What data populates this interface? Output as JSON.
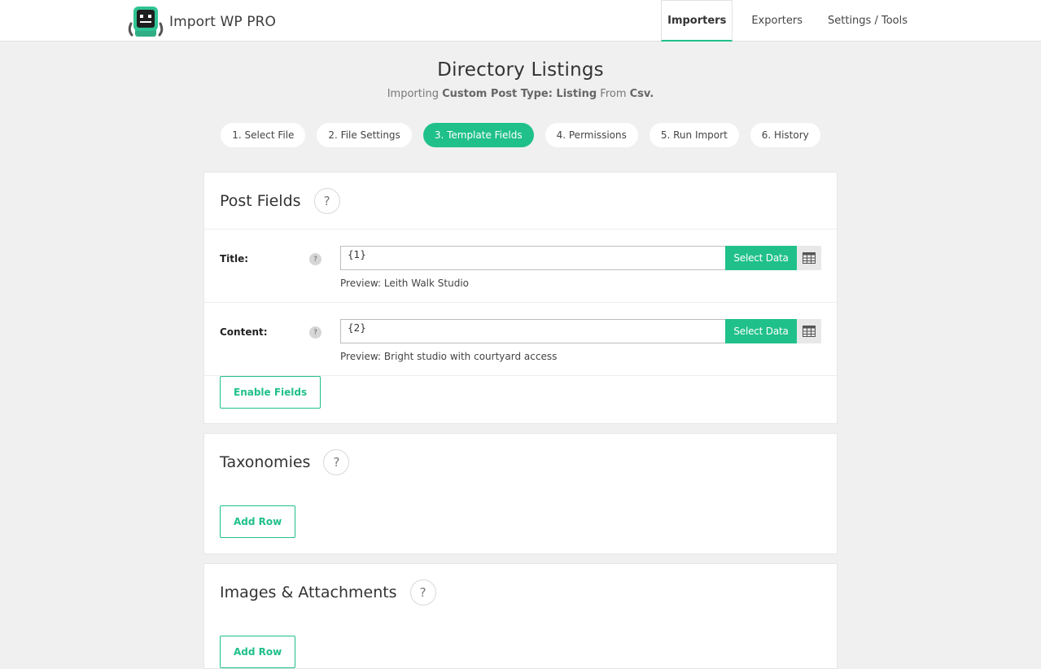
{
  "app": {
    "name": "Import WP PRO"
  },
  "nav": {
    "items": [
      {
        "label": "Importers",
        "active": true
      },
      {
        "label": "Exporters",
        "active": false
      },
      {
        "label": "Settings / Tools",
        "active": false
      }
    ]
  },
  "page": {
    "title": "Directory Listings",
    "sub_prefix": "Importing",
    "sub_type": "Custom Post Type: Listing",
    "sub_from": "From",
    "sub_source": "Csv."
  },
  "steps": [
    {
      "label": "1. Select File",
      "active": false
    },
    {
      "label": "2. File Settings",
      "active": false
    },
    {
      "label": "3. Template Fields",
      "active": true
    },
    {
      "label": "4. Permissions",
      "active": false
    },
    {
      "label": "5. Run Import",
      "active": false
    },
    {
      "label": "6. History",
      "active": false
    }
  ],
  "post_fields": {
    "title": "Post Fields",
    "help": "?",
    "fields": [
      {
        "label": "Title:",
        "help": "?",
        "value": "{1}",
        "select_label": "Select Data",
        "preview": "Preview: Leith Walk Studio"
      },
      {
        "label": "Content:",
        "help": "?",
        "value": "{2}",
        "select_label": "Select Data",
        "preview": "Preview: Bright studio with courtyard access"
      }
    ],
    "enable_button": "Enable Fields"
  },
  "taxonomies": {
    "title": "Taxonomies",
    "help": "?",
    "add_button": "Add Row"
  },
  "attachments": {
    "title": "Images & Attachments",
    "help": "?",
    "add_button": "Add Row"
  },
  "colors": {
    "accent": "#20c08a",
    "background": "#f0f0f0"
  },
  "icons": {
    "logo": "robot-logo",
    "table": "table-icon"
  }
}
